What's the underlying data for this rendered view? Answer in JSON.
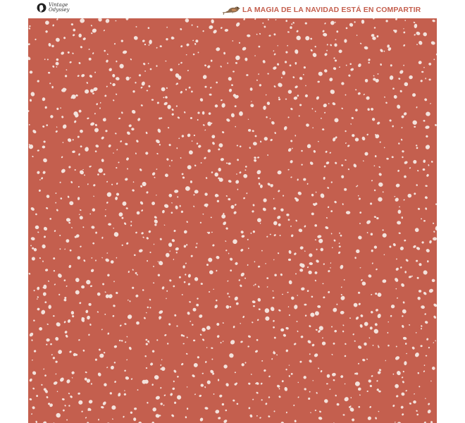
{
  "brand": {
    "line1": "Vintage",
    "line2": "Odyssey",
    "icon": "silhouette-logo-icon"
  },
  "tagline": {
    "text": "LA MAGIA DE LA NAVIDAD ESTÁ EN COMPARTIR",
    "icon": "bird-icon",
    "color": "#c45f4e"
  },
  "pattern": {
    "background_color": "#c45f4e",
    "dot_color": "#f3e2dc"
  }
}
